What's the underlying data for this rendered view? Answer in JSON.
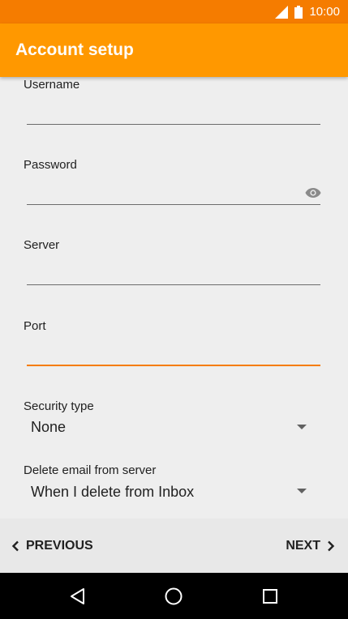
{
  "status_bar": {
    "time": "10:00",
    "icons": [
      "signal-icon",
      "battery-icon"
    ]
  },
  "app_bar": {
    "title": "Account setup"
  },
  "form": {
    "username": {
      "label": "Username",
      "value": ""
    },
    "password": {
      "label": "Password",
      "value": "",
      "icon": "eye-icon"
    },
    "server": {
      "label": "Server",
      "value": ""
    },
    "port": {
      "label": "Port",
      "value": ""
    },
    "security_type": {
      "label": "Security type",
      "value": "None"
    },
    "delete_email": {
      "label": "Delete email from server",
      "value": "When I delete from Inbox"
    }
  },
  "wizard": {
    "previous_label": "PREVIOUS",
    "next_label": "NEXT"
  },
  "system_nav": {
    "icons": [
      "back-icon",
      "home-icon",
      "recents-icon"
    ]
  },
  "colors": {
    "status_bar": "#f57c00",
    "app_bar": "#ff9800",
    "accent": "#f57c00",
    "background": "#eeeeee"
  }
}
